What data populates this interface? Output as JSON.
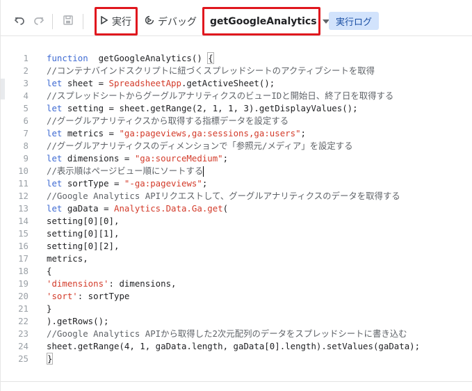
{
  "toolbar": {
    "undo_icon": "undo-icon",
    "redo_icon": "redo-icon",
    "save_icon": "save-icon",
    "run_label": "実行",
    "debug_label": "デバッグ",
    "function_selected": "getGoogleAnalytics",
    "log_label": "実行ログ",
    "highlight_color": "#e0171e"
  },
  "code": {
    "lines": [
      {
        "n": "1",
        "segments": [
          [
            "kw",
            "function"
          ],
          [
            "",
            "  getGoogleAnalytics() "
          ],
          [
            "box",
            "{"
          ]
        ]
      },
      {
        "n": "2",
        "segments": [
          [
            "cm",
            "//コンテナバインドスクリプトに紐づくスプレッドシートのアクティブシートを取得"
          ]
        ]
      },
      {
        "n": "3",
        "segments": [
          [
            "kw",
            "let"
          ],
          [
            "",
            " sheet = "
          ],
          [
            "cls",
            "SpreadsheetApp"
          ],
          [
            "",
            ".getActiveSheet();"
          ]
        ]
      },
      {
        "n": "4",
        "segments": [
          [
            "cm",
            "//スプレッドシートからグーグルアナリティクスのビューIDと開始日、終了日を取得する"
          ]
        ]
      },
      {
        "n": "5",
        "segments": [
          [
            "kw",
            "let"
          ],
          [
            "",
            " setting = sheet.getRange(2, 1, 1, 3).getDisplayValues();"
          ]
        ]
      },
      {
        "n": "6",
        "segments": [
          [
            "cm",
            "//グーグルアナリティクスから取得する指標データを設定する"
          ]
        ]
      },
      {
        "n": "7",
        "segments": [
          [
            "kw",
            "let"
          ],
          [
            "",
            " metrics = "
          ],
          [
            "str",
            "\"ga:pageviews,ga:sessions,ga:users\""
          ],
          [
            "",
            ";"
          ]
        ]
      },
      {
        "n": "8",
        "segments": [
          [
            "cm",
            "//グーグルアナリティクスのディメンションで「参照元/メディア」を設定する"
          ]
        ]
      },
      {
        "n": "9",
        "segments": [
          [
            "kw",
            "let"
          ],
          [
            "",
            " dimensions = "
          ],
          [
            "str",
            "\"ga:sourceMedium\""
          ],
          [
            "",
            ";"
          ]
        ]
      },
      {
        "n": "10",
        "segments": [
          [
            "cm",
            "//表示順はページビュー順にソートする"
          ],
          [
            "cursor",
            ""
          ]
        ]
      },
      {
        "n": "11",
        "segments": [
          [
            "kw",
            "let"
          ],
          [
            "",
            " sortType = "
          ],
          [
            "str",
            "\"-ga:pageviews\""
          ],
          [
            "",
            ";"
          ]
        ]
      },
      {
        "n": "12",
        "segments": [
          [
            "cm",
            "//Google Analytics APIリクエストして、グーグルアナリティクスのデータを取得する"
          ]
        ]
      },
      {
        "n": "13",
        "segments": [
          [
            "kw",
            "let"
          ],
          [
            "",
            " gaData = "
          ],
          [
            "cls",
            "Analytics.Data.Ga.get"
          ],
          [
            "",
            "("
          ]
        ]
      },
      {
        "n": "14",
        "segments": [
          [
            "",
            "setting[0][0],"
          ]
        ]
      },
      {
        "n": "15",
        "segments": [
          [
            "",
            "setting[0][1],"
          ]
        ]
      },
      {
        "n": "16",
        "segments": [
          [
            "",
            "setting[0][2],"
          ]
        ]
      },
      {
        "n": "17",
        "segments": [
          [
            "",
            "metrics,"
          ]
        ]
      },
      {
        "n": "18",
        "segments": [
          [
            "",
            "{"
          ]
        ]
      },
      {
        "n": "19",
        "segments": [
          [
            "str",
            "'dimensions'"
          ],
          [
            "",
            ": dimensions,"
          ]
        ]
      },
      {
        "n": "20",
        "segments": [
          [
            "str",
            "'sort'"
          ],
          [
            "",
            ": sortType"
          ]
        ]
      },
      {
        "n": "21",
        "segments": [
          [
            "",
            "}"
          ]
        ]
      },
      {
        "n": "22",
        "segments": [
          [
            "",
            ").getRows();"
          ]
        ]
      },
      {
        "n": "23",
        "segments": [
          [
            "cm",
            "//Google Analytics APIから取得した2次元配列のデータをスプレッドシートに書き込む"
          ]
        ]
      },
      {
        "n": "24",
        "segments": [
          [
            "",
            "sheet.getRange(4, 1, gaData.length, gaData[0].length).setValues(gaData);"
          ]
        ]
      },
      {
        "n": "25",
        "segments": [
          [
            "box",
            "}"
          ]
        ]
      }
    ]
  }
}
